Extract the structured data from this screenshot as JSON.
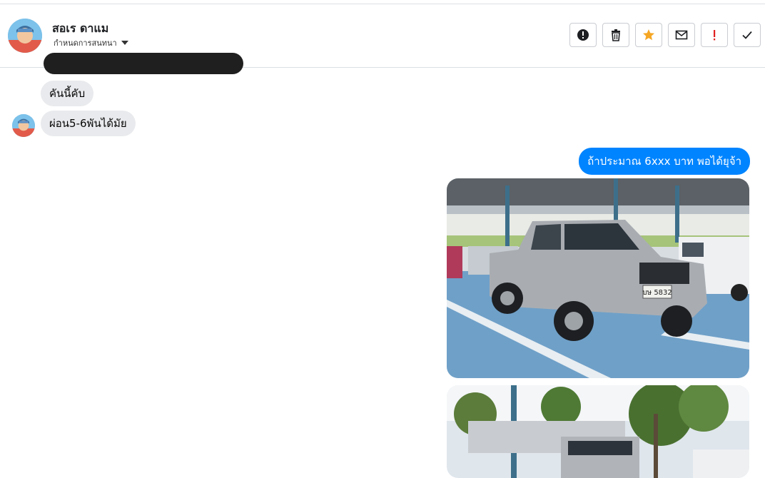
{
  "contact": {
    "name": "สอเร ดาแม",
    "subtitle": "กำหนดการสนทนา"
  },
  "toolbar": [
    {
      "name": "report-button",
      "icon": "alert-circle-icon"
    },
    {
      "name": "delete-button",
      "icon": "trash-icon"
    },
    {
      "name": "star-button",
      "icon": "star-icon",
      "color": "#f5a623"
    },
    {
      "name": "mark-unread-button",
      "icon": "envelope-icon"
    },
    {
      "name": "important-button",
      "icon": "exclamation-icon",
      "color": "#e02020"
    },
    {
      "name": "done-button",
      "icon": "checkmark-icon"
    }
  ],
  "messages": {
    "incoming": [
      "คันนี้คับ",
      "ผ่อน5-6พันได้มัย"
    ],
    "outgoing": [
      "ถ้าประมาณ 6xxx บาท พอได้ยุจ้า"
    ],
    "photo1": {
      "plate": "บษ 5832"
    }
  },
  "colors": {
    "outgoing_bubble": "#0084ff",
    "incoming_bubble": "#e9eaed"
  }
}
